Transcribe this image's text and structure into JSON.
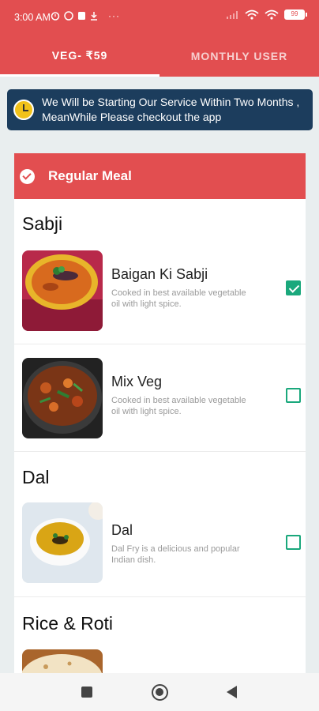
{
  "status_bar": {
    "time": "3:00 AM",
    "left_icons": [
      "alarm-icon",
      "whatsapp-icon",
      "sim-icon",
      "download-icon",
      "more-icon"
    ],
    "right_icons": [
      "signal-icon",
      "wifi-icon",
      "wifi-icon",
      "battery-icon"
    ],
    "battery": "99"
  },
  "tabs": [
    {
      "label": "VEG- ₹59",
      "active": true
    },
    {
      "label": "MONTHLY USER",
      "active": false
    }
  ],
  "notice": {
    "icon": "clock-icon",
    "text": "We Will be Starting Our Service Within Two Months , MeanWhile Please checkout the app"
  },
  "meal_card": {
    "title": "Regular Meal",
    "sections": [
      {
        "title": "Sabji",
        "items": [
          {
            "name": "Baigan Ki Sabji",
            "description": "Cooked in best available vegetable oil with light spice.",
            "selected": true
          },
          {
            "name": "Mix Veg",
            "description": "Cooked in best available vegetable oil with light spice.",
            "selected": false
          }
        ]
      },
      {
        "title": "Dal",
        "items": [
          {
            "name": "Dal",
            "description": "Dal Fry is a delicious and popular Indian dish.",
            "selected": false
          }
        ]
      },
      {
        "title": "Rice & Roti",
        "items": []
      }
    ]
  },
  "colors": {
    "brand_red": "#e24e50",
    "notice_bg": "#1c3d5d",
    "check_green": "#1aa87c"
  }
}
